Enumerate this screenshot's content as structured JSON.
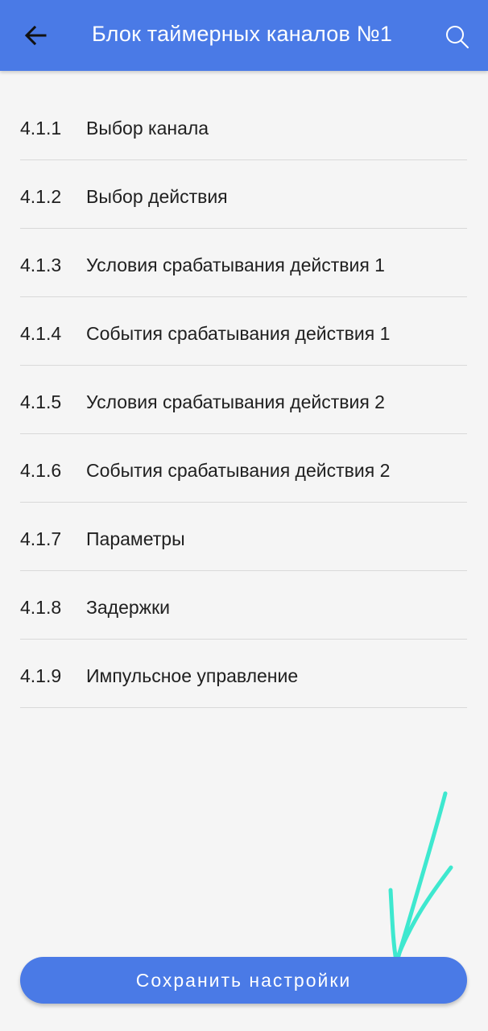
{
  "header": {
    "title": "Блок таймерных каналов №1",
    "back_icon": "arrow-left-icon",
    "search_icon": "search-icon",
    "background": "#4a7ae6"
  },
  "items": [
    {
      "number": "4.1.1",
      "label": "Выбор канала"
    },
    {
      "number": "4.1.2",
      "label": "Выбор действия"
    },
    {
      "number": "4.1.3",
      "label": "Условия срабатывания действия 1"
    },
    {
      "number": "4.1.4",
      "label": "События срабатывания действия 1"
    },
    {
      "number": "4.1.5",
      "label": "Условия срабатывания действия 2"
    },
    {
      "number": "4.1.6",
      "label": "События срабатывания действия 2"
    },
    {
      "number": "4.1.7",
      "label": "Параметры"
    },
    {
      "number": "4.1.8",
      "label": "Задержки"
    },
    {
      "number": "4.1.9",
      "label": "Импульсное управление"
    }
  ],
  "save_button": {
    "label": "Сохранить настройки",
    "background": "#4a7ae6"
  },
  "annotation": {
    "icon": "hand-drawn-arrow-icon",
    "color": "#3ee8cf"
  }
}
